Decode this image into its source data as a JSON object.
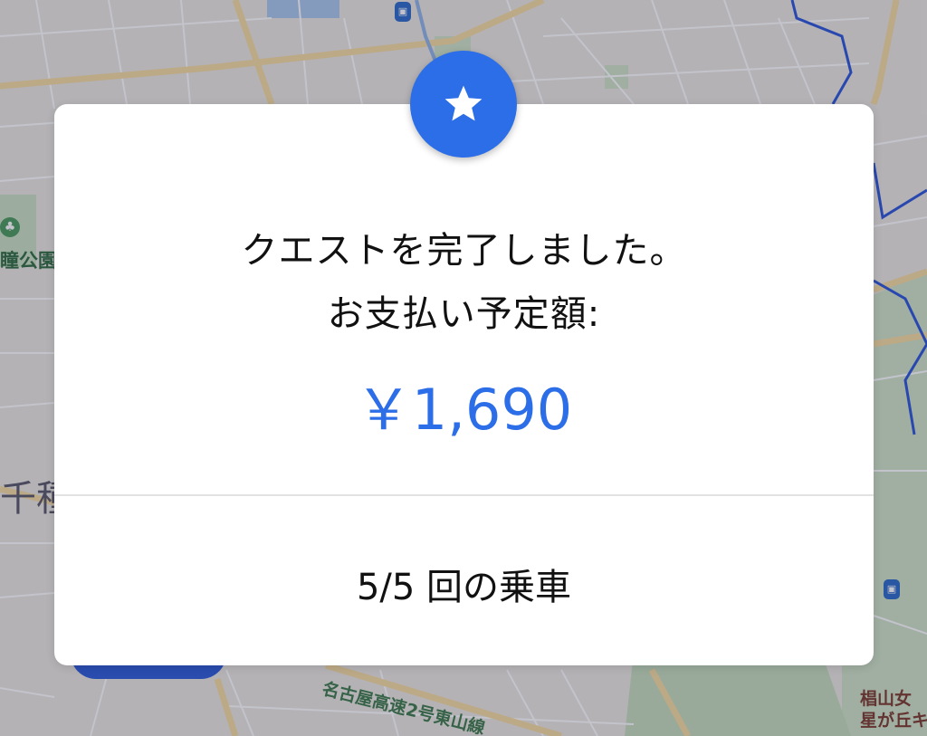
{
  "map": {
    "park_label": "瞳公園",
    "district_label": "千種",
    "highway_label": "名古屋高速2号東山線",
    "school_label_line1": "椙山女",
    "school_label_line2": "星が丘キ"
  },
  "quest_card": {
    "title_line1": "クエストを完了しました。",
    "title_line2": "お支払い予定額:",
    "amount": "￥1,690",
    "rides_text": "5/5 回の乗車",
    "icon": "star-icon"
  },
  "colors": {
    "accent": "#2b6ee8",
    "card_background": "#ffffff",
    "text": "#111111",
    "divider": "#e2e2e2"
  }
}
